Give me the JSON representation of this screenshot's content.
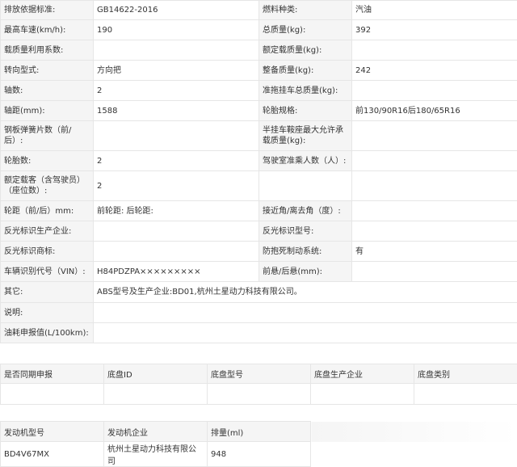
{
  "spec_rows": [
    {
      "l1": "排放依据标准:",
      "v1": "GB14622-2016",
      "l2": "燃料种类:",
      "v2": "汽油"
    },
    {
      "l1": "最高车速(km/h):",
      "v1": "190",
      "l2": "总质量(kg):",
      "v2": "392"
    },
    {
      "l1": "载质量利用系数:",
      "v1": "",
      "l2": "额定载质量(kg):",
      "v2": ""
    },
    {
      "l1": "转向型式:",
      "v1": "方向把",
      "l2": "整备质量(kg):",
      "v2": "242"
    },
    {
      "l1": "轴数:",
      "v1": "2",
      "l2": "准拖挂车总质量(kg):",
      "v2": ""
    },
    {
      "l1": "轴距(mm):",
      "v1": "1588",
      "l2": "轮胎规格:",
      "v2": "前130/90R16后180/65R16"
    },
    {
      "l1": "钢板弹簧片数（前/后）:",
      "v1": "",
      "l2": "半挂车鞍座最大允许承载质量(kg):",
      "v2": ""
    },
    {
      "l1": "轮胎数:",
      "v1": "2",
      "l2": "驾驶室准乘人数（人）:",
      "v2": ""
    },
    {
      "l1": "额定载客（含驾驶员）（座位数）:",
      "v1": "2",
      "l2": "",
      "v2": ""
    },
    {
      "l1": "轮距（前/后）mm:",
      "v1": "前轮距: 后轮距:",
      "l2": "接近角/离去角（度）:",
      "v2": ""
    },
    {
      "l1": "反光标识生产企业:",
      "v1": "",
      "l2": "反光标识型号:",
      "v2": ""
    },
    {
      "l1": "反光标识商标:",
      "v1": "",
      "l2": "防抱死制动系统:",
      "v2": "有"
    },
    {
      "l1": "车辆识别代号（VIN）:",
      "v1": "H84PDZPA×××××××××",
      "l2": "前悬/后悬(mm):",
      "v2": ""
    },
    {
      "l1": "其它:",
      "v1": "ABS型号及生产企业:BD01,杭州土星动力科技有限公司。"
    },
    {
      "l1": "说明:",
      "v1": ""
    },
    {
      "l1": "油耗申报值(L/100km):",
      "v1": ""
    }
  ],
  "chassis": {
    "headers": [
      "是否同期申报",
      "底盘ID",
      "底盘型号",
      "底盘生产企业",
      "底盘类别"
    ],
    "row": [
      "",
      "",
      "",
      "",
      ""
    ]
  },
  "engine": {
    "headers": [
      "发动机型号",
      "发动机企业",
      "排量(ml)"
    ],
    "row": [
      "BD4V67MX",
      "杭州土星动力科技有限公司",
      "948"
    ]
  }
}
